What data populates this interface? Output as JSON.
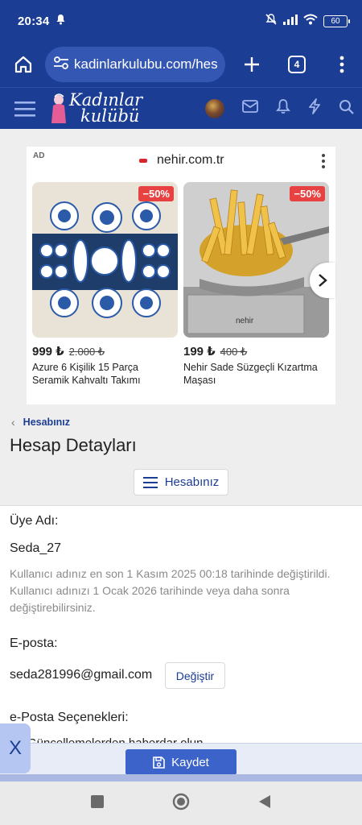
{
  "status_bar": {
    "time": "20:34",
    "battery": "60"
  },
  "browser": {
    "url": "kadinlarkulubu.com/hesap",
    "tab_count": "4"
  },
  "site": {
    "logo_line1": "Kadınlar",
    "logo_line2": "kulübü"
  },
  "ad": {
    "label": "AD",
    "advertiser": "nehir.com.tr",
    "products": [
      {
        "discount": "−50%",
        "price": "999 ₺",
        "old_price": "2.000 ₺",
        "title": "Azure 6 Kişilik 15 Parça Seramik Kahvaltı Takımı"
      },
      {
        "discount": "−50%",
        "price": "199 ₺",
        "old_price": "400 ₺",
        "title": "Nehir Sade Süzgeçli Kızartma Maşası"
      }
    ]
  },
  "page": {
    "breadcrumb": "Hesabınız",
    "title": "Hesap Detayları",
    "account_menu_button": "Hesabınız"
  },
  "form": {
    "username_label": "Üye Adı:",
    "username_value": "Seda_27",
    "username_hint": "Kullanıcı adınız en son 1 Kasım 2025 00:18 tarihinde değiştirildi. Kullanıcı adınızı 1 Ocak 2026 tarihinde veya daha sonra değiştirebilirsiniz.",
    "email_label": "E-posta:",
    "email_value": "seda281996@gmail.com",
    "change_button": "Değiştir",
    "email_options_label": "e-Posta Seçenekleri:",
    "email_option_1": "Güncellemelerden haberdar olun"
  },
  "footer": {
    "save_button": "Kaydet",
    "close_tab": "X"
  },
  "colors": {
    "brand": "#1c3d94",
    "save": "#3b63c9",
    "badge": "#e84141"
  }
}
